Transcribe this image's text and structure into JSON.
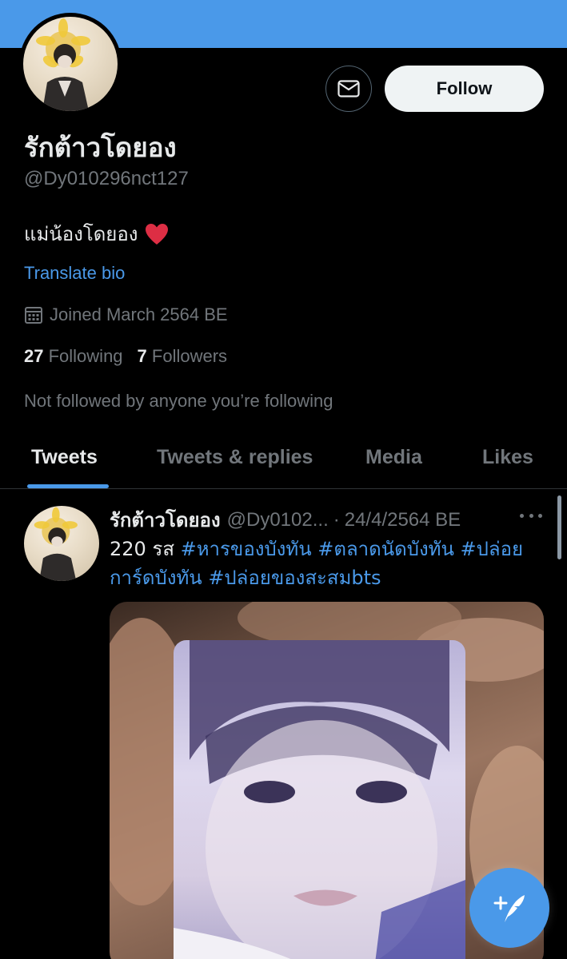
{
  "profile": {
    "display_name": "รักต้าวโดยอง",
    "handle": "@Dy010296nct127",
    "bio_text": "แม่น้องโดยอง",
    "bio_emoji": "red-heart",
    "translate_label": "Translate bio",
    "joined": "Joined March 2564 BE",
    "following_count": "27",
    "following_label": "Following",
    "followers_count": "7",
    "followers_label": "Followers",
    "not_followed": "Not followed by anyone you’re following"
  },
  "actions": {
    "message_icon": "envelope-icon",
    "follow_label": "Follow"
  },
  "tabs": [
    {
      "label": "Tweets",
      "active": true
    },
    {
      "label": "Tweets & replies",
      "active": false
    },
    {
      "label": "Media",
      "active": false
    },
    {
      "label": "Likes",
      "active": false
    }
  ],
  "tweet": {
    "name": "รักต้าวโดยอง",
    "handle": "@Dy0102...",
    "separator": "·",
    "date": "24/4/2564 BE",
    "text_prefix": "220 รส ",
    "hashtags": [
      "#หารของบังทัน",
      "#ตลาดนัดบังทัน",
      "#ปล่อยการ์ดบังทัน",
      "#ปล่อยของสะสมbts"
    ]
  },
  "colors": {
    "accent": "#4a99e9",
    "background": "#000000",
    "text_primary": "#e7e9ea",
    "text_secondary": "#71767b"
  }
}
